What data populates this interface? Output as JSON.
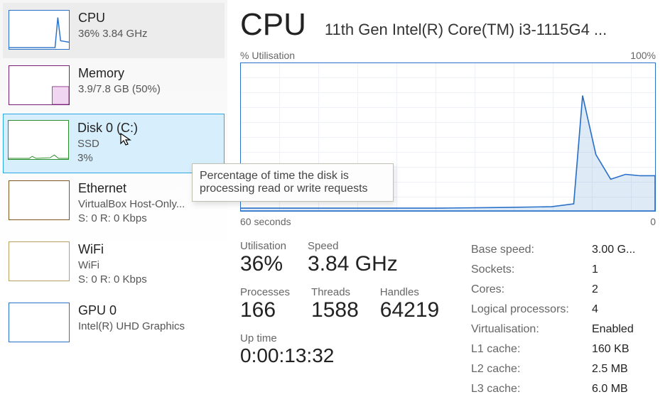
{
  "sidebar": [
    {
      "id": "cpu",
      "title": "CPU",
      "sub": "36%  3.84 GHz",
      "thumbColor": "#2a71c9"
    },
    {
      "id": "mem",
      "title": "Memory",
      "sub": "3.9/7.8 GB (50%)",
      "thumbColor": "#7a1f7a"
    },
    {
      "id": "disk",
      "title": "Disk 0 (C:)",
      "sub": "SSD",
      "sub2": "3%",
      "thumbColor": "#2a8f2a"
    },
    {
      "id": "eth",
      "title": "Ethernet",
      "sub": "VirtualBox Host-Only...",
      "sub2": "S: 0  R: 0 Kbps",
      "thumbColor": "#7a5a1a"
    },
    {
      "id": "wifi",
      "title": "WiFi",
      "sub": "WiFi",
      "sub2": "S: 0  R: 0 Kbps",
      "thumbColor": "#b8a060"
    },
    {
      "id": "gpu",
      "title": "GPU 0",
      "sub": "Intel(R) UHD Graphics",
      "thumbColor": "#2a71c9"
    }
  ],
  "main": {
    "title": "CPU",
    "model": "11th Gen Intel(R) Core(TM) i3-1115G4 ...",
    "chart": {
      "topLeft": "% Utilisation",
      "topRight": "100%",
      "bottomLeft": "60 seconds",
      "bottomRight": "0"
    },
    "big": [
      {
        "label": "Utilisation",
        "value": "36%"
      },
      {
        "label": "Speed",
        "value": "3.84 GHz"
      }
    ],
    "big2": [
      {
        "label": "Processes",
        "value": "166"
      },
      {
        "label": "Threads",
        "value": "1588"
      },
      {
        "label": "Handles",
        "value": "64219"
      }
    ],
    "uptime": {
      "label": "Up time",
      "value": "0:00:13:32"
    },
    "facts": [
      {
        "k": "Base speed:",
        "v": "3.00 G..."
      },
      {
        "k": "Sockets:",
        "v": "1"
      },
      {
        "k": "Cores:",
        "v": "2"
      },
      {
        "k": "Logical processors:",
        "v": "4"
      },
      {
        "k": "Virtualisation:",
        "v": "Enabled"
      },
      {
        "k": "L1 cache:",
        "v": "160 KB"
      },
      {
        "k": "L2 cache:",
        "v": "2.5 MB"
      },
      {
        "k": "L3 cache:",
        "v": "6.0 MB"
      }
    ]
  },
  "tooltip": "Percentage of time the disk is processing read or write requests",
  "chart_data": {
    "type": "line",
    "title": "% Utilisation",
    "xlabel": "seconds",
    "ylabel": "% Utilisation",
    "xlim": [
      60,
      0
    ],
    "ylim": [
      0,
      100
    ],
    "x": [
      60,
      55,
      50,
      45,
      40,
      35,
      30,
      25,
      20,
      15,
      12,
      10,
      8,
      6,
      4,
      2,
      0
    ],
    "values": [
      2,
      2,
      2,
      2,
      2,
      2,
      2,
      2,
      2,
      3,
      5,
      78,
      38,
      22,
      26,
      24,
      24
    ]
  }
}
